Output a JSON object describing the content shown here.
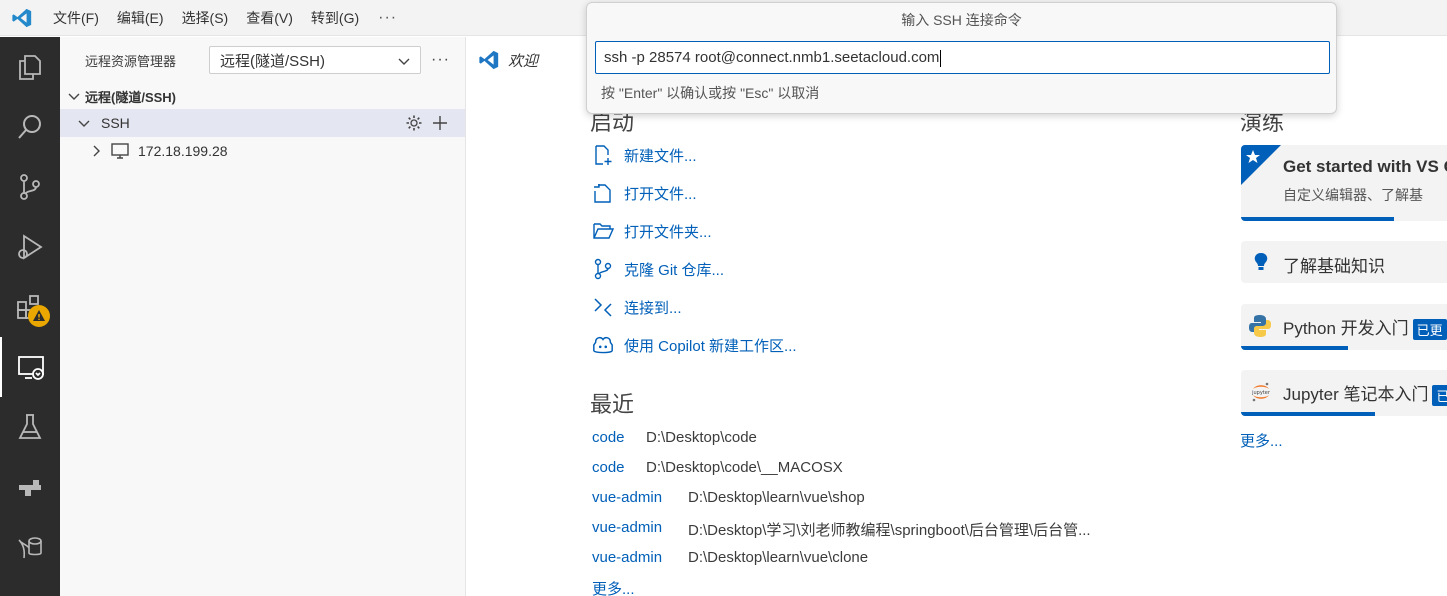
{
  "titlebar": {
    "menus": [
      "文件(F)",
      "编辑(E)",
      "选择(S)",
      "查看(V)",
      "转到(G)"
    ],
    "more": "···"
  },
  "activitybar": {
    "items": [
      "explorer-icon",
      "search-icon",
      "source-control-icon",
      "run-debug-icon",
      "extensions-icon",
      "remote-explorer-icon",
      "testing-icon",
      "docker-icon",
      "database-icon"
    ],
    "active": "remote-explorer-icon"
  },
  "sidebar": {
    "title": "远程资源管理器",
    "select_value": "远程(隧道/SSH)",
    "more": "···",
    "section": "远程(隧道/SSH)",
    "group": "SSH",
    "host": "172.18.199.28"
  },
  "editor": {
    "tab_label": "欢迎",
    "start_title": "启动",
    "start_items": [
      "新建文件...",
      "打开文件...",
      "打开文件夹...",
      "克隆 Git 仓库...",
      "连接到...",
      "使用 Copilot 新建工作区..."
    ],
    "recent_title": "最近",
    "recent": [
      {
        "name": "code",
        "path": "D:\\Desktop\\code"
      },
      {
        "name": "code",
        "path": "D:\\Desktop\\code\\__MACOSX"
      },
      {
        "name": "vue-admin",
        "path": "D:\\Desktop\\learn\\vue\\shop"
      },
      {
        "name": "vue-admin",
        "path": "D:\\Desktop\\学习\\刘老师教编程\\springboot\\后台管理\\后台管..."
      },
      {
        "name": "vue-admin",
        "path": "D:\\Desktop\\learn\\vue\\clone"
      }
    ],
    "recent_more": "更多...",
    "walk_title": "演练",
    "walkthroughs": [
      {
        "title": "Get started with VS C",
        "subtitle": "自定义编辑器、了解基"
      },
      {
        "title": "了解基础知识"
      },
      {
        "title": "Python 开发入门",
        "badge": "已更"
      },
      {
        "title": "Jupyter 笔记本入门",
        "badge": "已"
      }
    ],
    "walk_more": "更多..."
  },
  "quick_input": {
    "title": "输入 SSH 连接命令",
    "value": "ssh -p 28574 root@connect.nmb1.seetacloud.com",
    "hint": "按 \"Enter\" 以确认或按 \"Esc\" 以取消"
  },
  "colors": {
    "accent": "#005fb8",
    "activitybar": "#2c2c2c",
    "sidebar": "#f8f8f8",
    "warning": "#e9a700"
  }
}
